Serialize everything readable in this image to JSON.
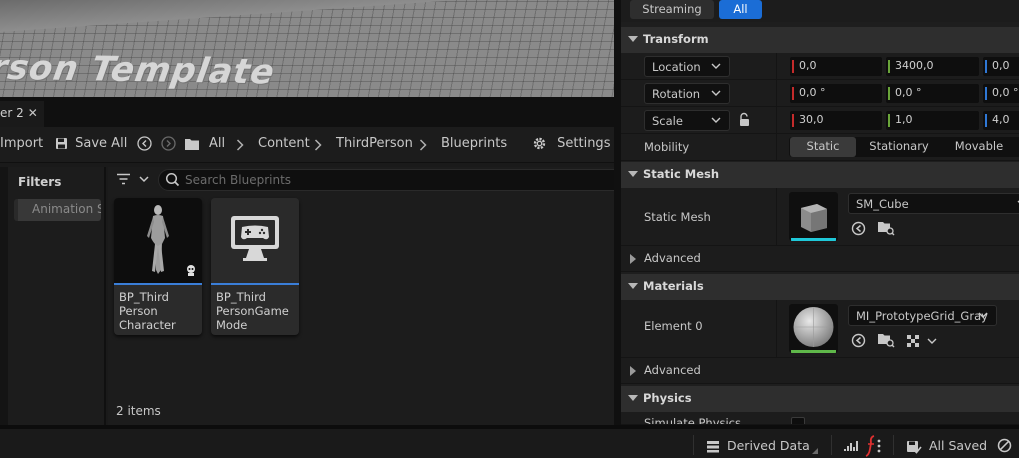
{
  "viewport": {
    "overlay_text": "rson Template"
  },
  "content_browser": {
    "tab_label": "er 2",
    "toolbar": {
      "import_label": "Import",
      "save_all_label": "Save All",
      "settings_label": "Settings"
    },
    "breadcrumbs": [
      "All",
      "Content",
      "ThirdPerson",
      "Blueprints"
    ],
    "filters_label": "Filters",
    "filter_chip": "Animation S",
    "search": {
      "placeholder": "Search Blueprints",
      "value": ""
    },
    "assets": [
      {
        "name": "BP_Third Person Character",
        "lines": [
          "BP_Third",
          "Person",
          "Character"
        ]
      },
      {
        "name": "BP_Third PersonGame Mode",
        "lines": [
          "BP_Third",
          "PersonGame",
          "Mode"
        ]
      }
    ],
    "item_count": "2 items"
  },
  "details": {
    "streaming": {
      "streaming_label": "Streaming",
      "all_label": "All"
    },
    "transform": {
      "header": "Transform",
      "location": {
        "mode": "Location",
        "x": "0,0",
        "y": "3400,0",
        "z": "0,0"
      },
      "rotation": {
        "mode": "Rotation",
        "x": "0,0 °",
        "y": "0,0 °",
        "z": "0,0 °"
      },
      "scale": {
        "mode": "Scale",
        "x": "30,0",
        "y": "1,0",
        "z": "4,0"
      },
      "mobility_label": "Mobility",
      "mobility_options": [
        "Static",
        "Stationary",
        "Movable"
      ],
      "mobility_selected": "Static"
    },
    "static_mesh": {
      "header": "Static Mesh",
      "row_label": "Static Mesh",
      "asset": "SM_Cube",
      "advanced_label": "Advanced"
    },
    "materials": {
      "header": "Materials",
      "element_label": "Element 0",
      "asset": "MI_PrototypeGrid_Gray",
      "advanced_label": "Advanced"
    },
    "physics": {
      "header": "Physics",
      "cut_row_label": "Simulate Physics"
    }
  },
  "status_bar": {
    "derived_data_label": "Derived Data",
    "all_saved_label": "All Saved"
  },
  "colors": {
    "accent_blue": "#1b6dd6",
    "axis_x": "#c42b2b",
    "axis_y": "#6aa53a",
    "axis_z": "#2f78d6",
    "selection_bar": "#3a7ed8"
  },
  "icons": [
    "save-icon",
    "back-icon",
    "forward-icon",
    "folder-icon",
    "chevron-right-icon",
    "gear-icon",
    "filter-icon",
    "search-icon",
    "lock-icon",
    "browse-icon",
    "use-selected-icon",
    "checker-icon",
    "derived-data-icon",
    "trace-icon",
    "source-control-icon",
    "revision-control-icon"
  ]
}
